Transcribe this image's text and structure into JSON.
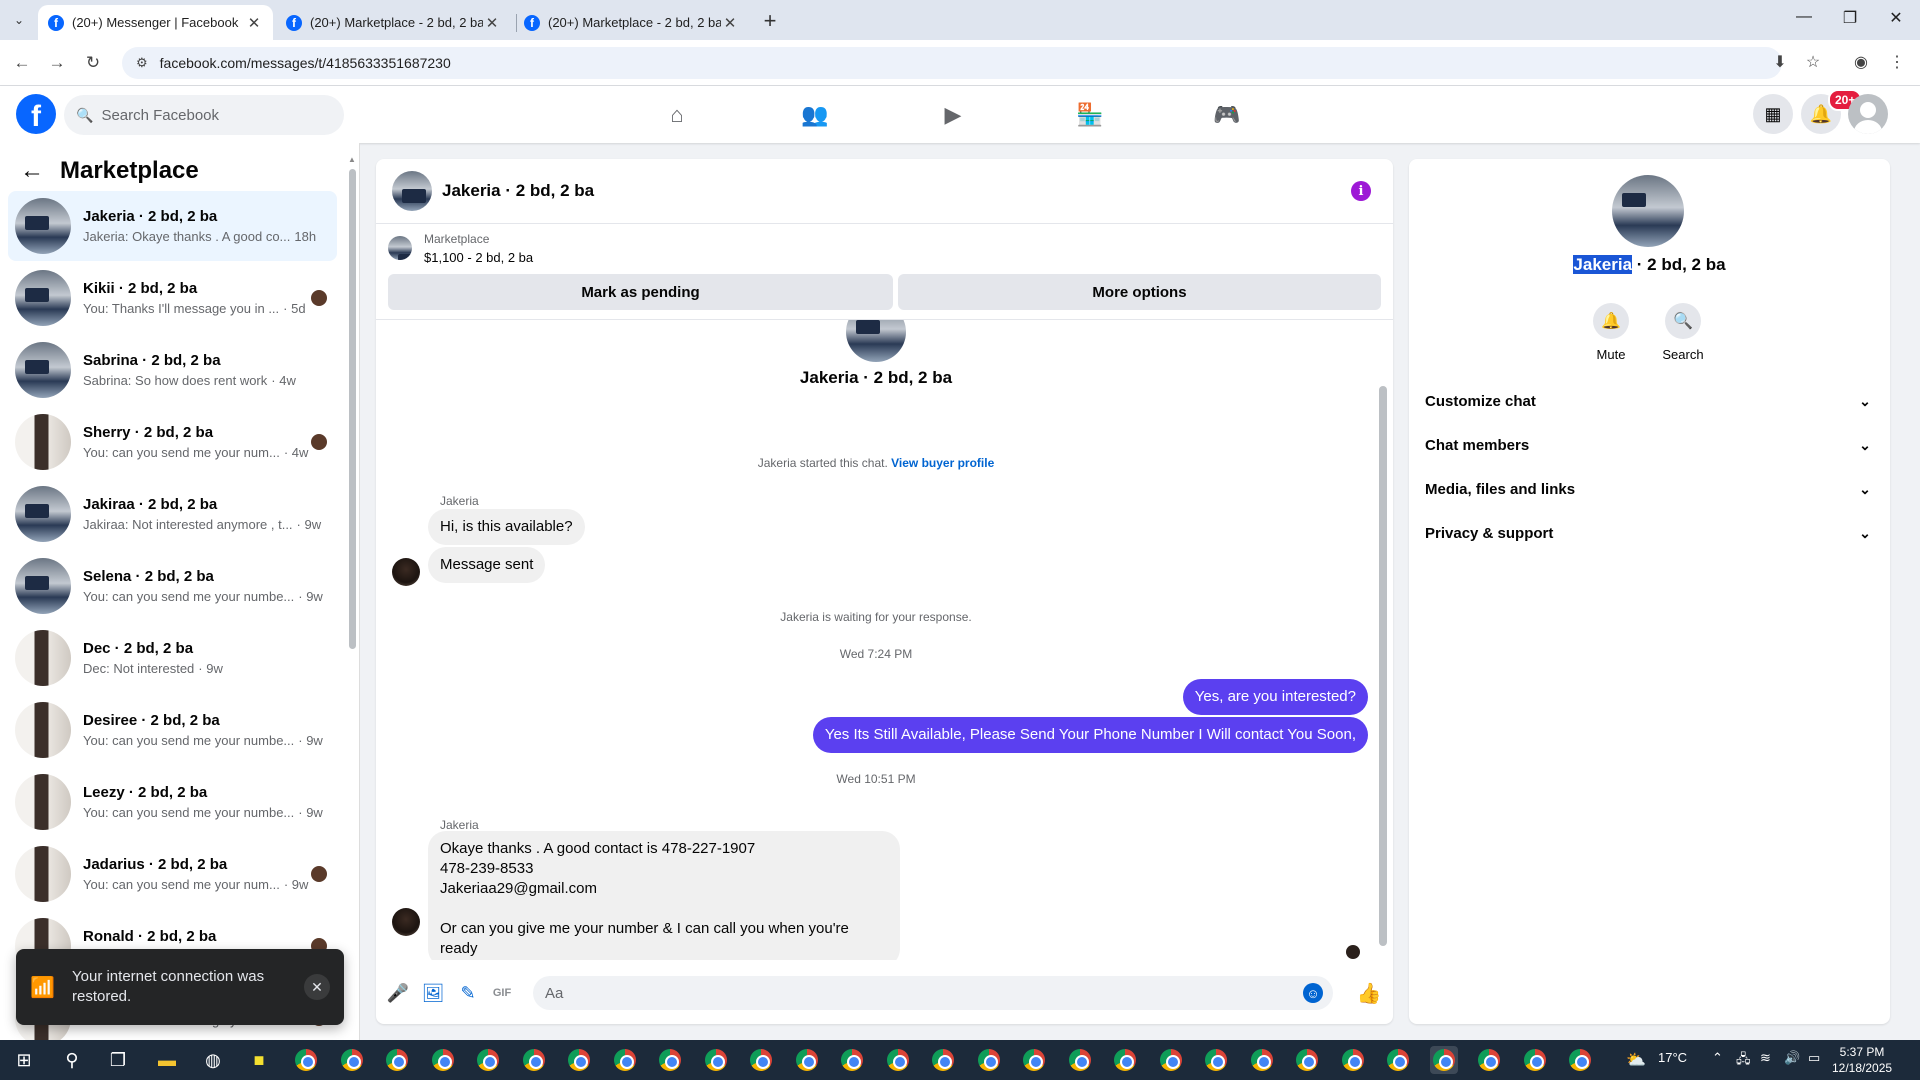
{
  "browser": {
    "tabs": [
      {
        "title": "(20+) Messenger | Facebook",
        "active": true
      },
      {
        "title": "(20+) Marketplace - 2 bd, 2 ba",
        "active": false
      },
      {
        "title": "(20+) Marketplace - 2 bd, 2 ba",
        "active": false
      }
    ],
    "url": "facebook.com/messages/t/4185633351687230",
    "icons": [
      "back-arrow-icon",
      "forward-arrow-icon",
      "reload-icon",
      "site-settings-icon",
      "install-icon",
      "star-icon",
      "profile-icon",
      "menu-icon"
    ]
  },
  "fb": {
    "logo": "f",
    "search_placeholder": "Search Facebook",
    "nav_icons": [
      "home-icon",
      "friends-icon",
      "video-icon",
      "marketplace-icon",
      "gaming-icon"
    ],
    "notification_badge": "20+",
    "accent": "#0866ff"
  },
  "left": {
    "title": "Marketplace",
    "conversations": [
      {
        "name": "Jakeria · 2 bd, 2 ba",
        "preview": "Jakeria: Okaye thanks . A good co...",
        "time": "18h",
        "selected": true,
        "avatar": "room",
        "mini": false
      },
      {
        "name": "Kikii · 2 bd, 2 ba",
        "preview": "You: Thanks I'll message you in ...",
        "time": "· 5d",
        "selected": false,
        "avatar": "room",
        "mini": true
      },
      {
        "name": "Sabrina · 2 bd, 2 ba",
        "preview": "Sabrina: So how does rent work",
        "time": "· 4w",
        "selected": false,
        "avatar": "room",
        "mini": false
      },
      {
        "name": "Sherry · 2 bd, 2 ba",
        "preview": "You: can you send me your num...",
        "time": "· 4w",
        "selected": false,
        "avatar": "door",
        "mini": true
      },
      {
        "name": "Jakiraa · 2 bd, 2 ba",
        "preview": "Jakiraa: Not interested anymore , t...",
        "time": "· 9w",
        "selected": false,
        "avatar": "room",
        "mini": false
      },
      {
        "name": "Selena · 2 bd, 2 ba",
        "preview": "You: can you send me your numbe...",
        "time": "· 9w",
        "selected": false,
        "avatar": "room",
        "mini": false
      },
      {
        "name": "Dec · 2 bd, 2 ba",
        "preview": "Dec: Not interested",
        "time": "· 9w",
        "selected": false,
        "avatar": "door",
        "mini": false
      },
      {
        "name": "Desiree · 2 bd, 2 ba",
        "preview": "You: can you send me your numbe...",
        "time": "· 9w",
        "selected": false,
        "avatar": "door",
        "mini": false
      },
      {
        "name": "Leezy · 2 bd, 2 ba",
        "preview": "You: can you send me your numbe...",
        "time": "· 9w",
        "selected": false,
        "avatar": "door",
        "mini": false
      },
      {
        "name": "Jadarius · 2 bd, 2 ba",
        "preview": "You: can you send me your num...",
        "time": "· 9w",
        "selected": false,
        "avatar": "door",
        "mini": true
      },
      {
        "name": "Ronald · 2 bd, 2 ba",
        "preview": "",
        "time": "",
        "selected": false,
        "avatar": "door",
        "mini": true
      },
      {
        "name": "",
        "preview": "You: Thanks I'll message you in...",
        "time": "· 18w",
        "selected": false,
        "avatar": "door",
        "mini": true
      }
    ],
    "toast": {
      "message": "Your internet connection was restored."
    }
  },
  "chat": {
    "header_name": "Jakeria · 2 bd, 2 ba",
    "listing_label": "Marketplace",
    "listing_detail": "$1,100 - 2 bd, 2 ba",
    "btn_pending": "Mark as pending",
    "btn_more": "More options",
    "profile_name": "Jakeria · 2 bd, 2 ba",
    "started_text": "Jakeria started this chat.",
    "view_profile": "View buyer profile",
    "sender1": "Jakeria",
    "msg1": "Hi, is this available?",
    "msg2": "Message sent",
    "waiting_text": "Jakeria is waiting for your response.",
    "time1": "Wed 7:24 PM",
    "out1": "Yes, are you interested?",
    "out2": "Yes Its Still Available, Please Send Your Phone Number I Will contact You Soon,",
    "time2": "Wed 10:51 PM",
    "sender2": "Jakeria",
    "msg3_lines": [
      "Okaye thanks . A good contact is 478-227-1907",
      "478-239-8533",
      "Jakeriaa29@gmail.com",
      "",
      "Or can you give me your number & I can call you when you're ready"
    ],
    "input_placeholder": "Aa",
    "outgoing_color": "#5b40f0"
  },
  "right": {
    "name_first": "Jakeria",
    "name_rest": " · 2 bd, 2 ba",
    "mute_label": "Mute",
    "search_label": "Search",
    "sections": [
      "Customize chat",
      "Chat members",
      "Media, files and links",
      "Privacy & support"
    ]
  },
  "taskbar": {
    "weather": "17°C",
    "time": "5:37 PM",
    "date": "12/18/2025"
  }
}
